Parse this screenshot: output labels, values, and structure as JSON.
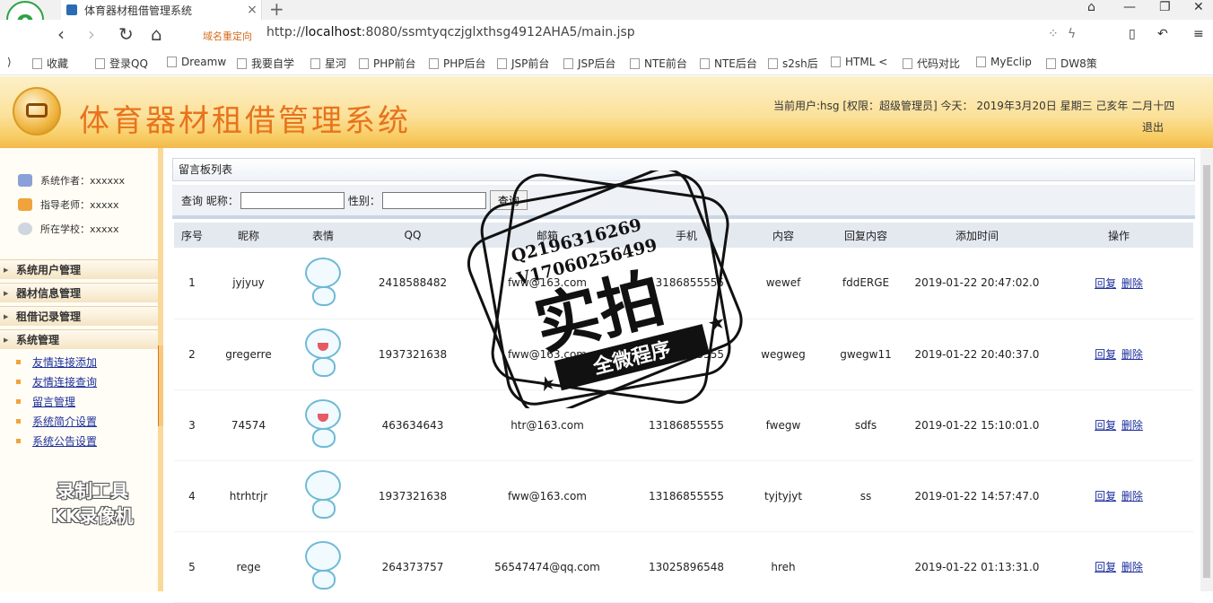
{
  "browser": {
    "tab_title": "体育器材租借管理系统",
    "redirect_label": "域名重定向",
    "url_prefix": "http://",
    "url_host": "localhost",
    "url_rest": ":8080/ssmtyqczjglxthsg4912AHA5/main.jsp",
    "bookmarks": [
      "收藏",
      "登录QQ",
      "Dreamw",
      "我要自学",
      "星河",
      "PHP前台",
      "PHP后台",
      "JSP前台",
      "JSP后台",
      "NTE前台",
      "NTE后台",
      "s2sh后",
      "HTML <",
      "代码对比",
      "MyEclip",
      "DW8策"
    ]
  },
  "header": {
    "title": "体育器材租借管理系统",
    "user_info": "当前用户:hsg [权限：超级管理员] 今天： 2019年3月20日 星期三 己亥年 二月十四",
    "logout": "退出"
  },
  "sidebar": {
    "info": [
      {
        "label": "系统作者：xxxxxx"
      },
      {
        "label": "指导老师：xxxxx"
      },
      {
        "label": "所在学校：xxxxx"
      }
    ],
    "menus": [
      "系统用户管理",
      "器材信息管理",
      "租借记录管理",
      "系统管理"
    ],
    "submenu": [
      "友情连接添加",
      "友情连接查询",
      "留言管理",
      "系统简介设置",
      "系统公告设置"
    ],
    "watermark": [
      "录制工具",
      "KK录像机"
    ]
  },
  "main": {
    "panel_title": "留言板列表",
    "search": {
      "prefix": "查询",
      "nick_label": "昵称：",
      "gender_label": "性别：",
      "button": "查询"
    },
    "columns": [
      "序号",
      "昵称",
      "表情",
      "QQ",
      "邮箱",
      "手机",
      "内容",
      "回复内容",
      "添加时间",
      "操作"
    ],
    "rows": [
      {
        "no": "1",
        "nick": "jyjyuy",
        "qq": "2418588482",
        "email": "fww@163.com",
        "phone": "13186855555",
        "content": "wewef",
        "reply": "fddERGE",
        "time": "2019-01-22 20:47:02.0"
      },
      {
        "no": "2",
        "nick": "gregerre",
        "qq": "1937321638",
        "email": "fww@163.com",
        "phone": "13186855555",
        "content": "wegweg",
        "reply": "gwegw11",
        "time": "2019-01-22 20:40:37.0"
      },
      {
        "no": "3",
        "nick": "74574",
        "qq": "463634643",
        "email": "htr@163.com",
        "phone": "13186855555",
        "content": "fwegw",
        "reply": "sdfs",
        "time": "2019-01-22 15:10:01.0"
      },
      {
        "no": "4",
        "nick": "htrhtrjr",
        "qq": "1937321638",
        "email": "fww@163.com",
        "phone": "13186855555",
        "content": "tyjtyjyt",
        "reply": "ss",
        "time": "2019-01-22 14:57:47.0"
      },
      {
        "no": "5",
        "nick": "rege",
        "qq": "264373757",
        "email": "56547474@qq.com",
        "phone": "13025896548",
        "content": "hreh",
        "reply": "",
        "time": "2019-01-22 01:13:31.0"
      }
    ],
    "actions": {
      "reply": "回复",
      "delete": "删除"
    }
  },
  "stamp": {
    "line1": "Q2196316269",
    "line2": "V17060256499",
    "big": "实拍",
    "ribbon": "全微程序"
  },
  "colors": {
    "title_orange": "#e8731b",
    "link_blue": "#1d2f9d"
  }
}
